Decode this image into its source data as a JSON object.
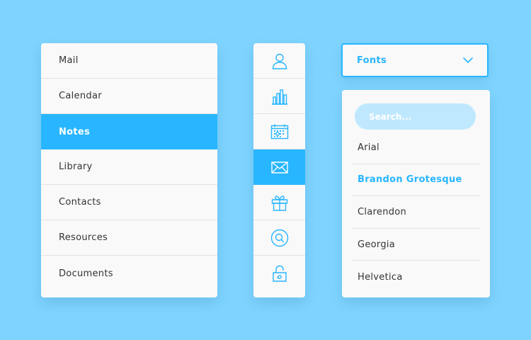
{
  "menu": {
    "items": [
      {
        "label": "Mail"
      },
      {
        "label": "Calendar"
      },
      {
        "label": "Notes",
        "active": true
      },
      {
        "label": "Library"
      },
      {
        "label": "Contacts"
      },
      {
        "label": "Resources"
      },
      {
        "label": "Documents"
      }
    ]
  },
  "iconbar": {
    "items": [
      {
        "icon": "user-icon"
      },
      {
        "icon": "bar-chart-icon"
      },
      {
        "icon": "calendar-icon"
      },
      {
        "icon": "mail-icon",
        "active": true
      },
      {
        "icon": "gift-icon"
      },
      {
        "icon": "search-circle-icon"
      },
      {
        "icon": "lock-icon"
      }
    ]
  },
  "font_select": {
    "label": "Fonts",
    "search_placeholder": "Search...",
    "options": [
      {
        "label": "Arial"
      },
      {
        "label": "Brandon Grotesque",
        "selected": true
      },
      {
        "label": "Clarendon"
      },
      {
        "label": "Georgia"
      },
      {
        "label": "Helvetica"
      }
    ]
  },
  "colors": {
    "background": "#7fd4ff",
    "accent": "#27b6ff",
    "panel": "#f9f9f9",
    "search_fill": "#bfe8ff"
  }
}
